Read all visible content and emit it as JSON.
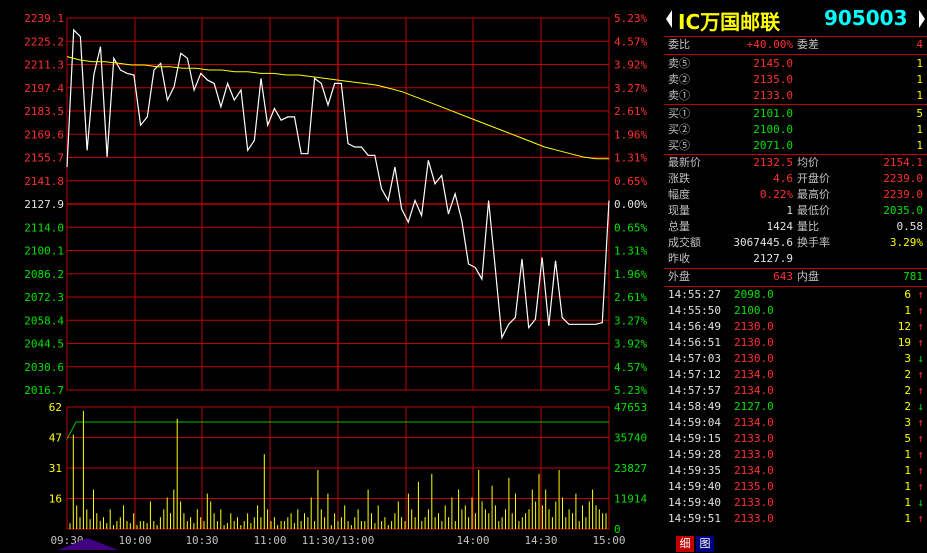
{
  "price_axis_left": [
    "2239.1",
    "2225.2",
    "2211.3",
    "2197.4",
    "2183.5",
    "2169.6",
    "2155.7",
    "2141.8",
    "2127.9",
    "2114.0",
    "2100.1",
    "2086.2",
    "2072.3",
    "2058.4",
    "2044.5",
    "2030.6",
    "2016.7"
  ],
  "price_axis_right": [
    "5.23%",
    "4.57%",
    "3.92%",
    "3.27%",
    "2.61%",
    "1.96%",
    "1.31%",
    "0.65%",
    "0.00%",
    "0.65%",
    "1.31%",
    "1.96%",
    "2.61%",
    "3.27%",
    "3.92%",
    "4.57%",
    "5.23%"
  ],
  "vol_axis_left": [
    "62",
    "47",
    "31",
    "16"
  ],
  "vol_axis_right": [
    "47653",
    "35740",
    "23827",
    "11914",
    "0"
  ],
  "time_labels": [
    "09:30",
    "10:00",
    "10:30",
    "11:00",
    "11:30/13:00",
    "14:00",
    "14:30",
    "15:00"
  ],
  "chart_data": {
    "type": "line",
    "series": [
      {
        "values": [
          2150,
          2232,
          2228,
          2160,
          2205,
          2222,
          2156,
          2215,
          2208,
          2206,
          2205,
          2175,
          2180,
          2208,
          2212,
          2190,
          2198,
          2218,
          2215,
          2196,
          2206,
          2202,
          2200,
          2186,
          2200,
          2190,
          2196,
          2160,
          2166,
          2203,
          2175,
          2185,
          2178,
          2180,
          2180,
          2158,
          2158,
          2203,
          2200,
          2187,
          2200,
          2200,
          2164,
          2162,
          2162,
          2157,
          2157,
          2137,
          2130,
          2150,
          2125,
          2117,
          2130,
          2121,
          2154,
          2140,
          2145,
          2122,
          2134,
          2118,
          2092,
          2090,
          2083,
          2130,
          2090,
          2048,
          2056,
          2060,
          2095,
          2054,
          2059,
          2096,
          2055,
          2094,
          2060,
          2056,
          2056,
          2056,
          2056,
          2056,
          2057,
          2130
        ]
      },
      {
        "values": [
          2216,
          2214,
          2213,
          2213,
          2212,
          2211,
          2211,
          2210,
          2210,
          2209,
          2209,
          2208,
          2208,
          2207,
          2207,
          2206,
          2206,
          2205,
          2205,
          2204,
          2203,
          2202,
          2201,
          2200,
          2199,
          2197,
          2195,
          2192,
          2189,
          2186,
          2183,
          2180,
          2177,
          2174,
          2171,
          2168,
          2165,
          2162,
          2160,
          2158,
          2156,
          2155,
          2155
        ]
      }
    ],
    "volume_values": [
      3,
      48,
      12,
      6,
      60,
      10,
      5,
      20,
      8,
      4,
      6,
      3,
      10,
      2,
      4,
      6,
      12,
      4,
      3,
      8,
      2,
      4,
      4,
      3,
      14,
      4,
      2,
      6,
      10,
      16,
      8,
      20,
      56,
      14,
      8,
      4,
      6,
      3,
      10,
      6,
      4,
      18,
      14,
      8,
      4,
      10,
      2,
      3,
      8,
      4,
      6,
      2,
      4,
      8,
      3,
      6,
      12,
      6,
      38,
      10,
      4,
      6,
      2,
      4,
      4,
      6,
      8,
      3,
      10,
      4,
      8,
      6,
      16,
      4,
      30,
      10,
      6,
      18,
      2,
      8,
      4,
      6,
      12,
      4,
      2,
      6,
      10,
      4,
      4,
      20,
      8,
      3,
      12,
      4,
      6,
      2,
      4,
      8,
      14,
      6,
      4,
      18,
      10,
      6,
      24,
      4,
      6,
      10,
      28,
      6,
      8,
      4,
      12,
      6,
      16,
      4,
      20,
      10,
      12,
      6,
      16,
      8,
      30,
      14,
      10,
      8,
      22,
      12,
      4,
      6,
      10,
      26,
      8,
      18,
      4,
      6,
      8,
      10,
      20,
      14,
      28,
      12,
      20,
      10,
      6,
      14,
      30,
      16,
      6,
      10,
      8,
      18,
      4,
      12,
      6,
      14,
      20,
      12,
      10,
      8,
      8
    ]
  },
  "panel": {
    "title_name": "IC万国邮联",
    "title_code": "905003",
    "weibi_label": "委比",
    "weibi_value": "+40.00%",
    "weicha_label": "委差",
    "weicha_value": "4",
    "asks": [
      {
        "label": "卖⑤",
        "price": "2145.0",
        "vol": "1"
      },
      {
        "label": "卖②",
        "price": "2135.0",
        "vol": "1"
      },
      {
        "label": "卖①",
        "price": "2133.0",
        "vol": "1"
      }
    ],
    "bids": [
      {
        "label": "买①",
        "price": "2101.0",
        "vol": "5"
      },
      {
        "label": "买②",
        "price": "2100.0",
        "vol": "1"
      },
      {
        "label": "买⑤",
        "price": "2071.0",
        "vol": "1"
      }
    ],
    "stats": [
      {
        "l1": "最新价",
        "v1": "2132.5",
        "c1": "red",
        "l2": "均价",
        "v2": "2154.1",
        "c2": "red"
      },
      {
        "l1": "涨跌",
        "v1": "4.6",
        "c1": "red",
        "l2": "开盘价",
        "v2": "2239.0",
        "c2": "red"
      },
      {
        "l1": "幅度",
        "v1": "0.22%",
        "c1": "red",
        "l2": "最高价",
        "v2": "2239.0",
        "c2": "red"
      },
      {
        "l1": "现量",
        "v1": "1",
        "c1": "wht",
        "l2": "最低价",
        "v2": "2035.0",
        "c2": "grn"
      },
      {
        "l1": "总量",
        "v1": "1424",
        "c1": "wht",
        "l2": "量比",
        "v2": "0.58",
        "c2": "wht"
      },
      {
        "l1": "成交额",
        "v1": "3067445.6",
        "c1": "wht",
        "l2": "换手率",
        "v2": "3.29%",
        "c2": "yel"
      },
      {
        "l1": "昨收",
        "v1": "2127.9",
        "c1": "wht",
        "l2": "",
        "v2": "",
        "c2": "wht"
      }
    ],
    "waipan_label": "外盘",
    "waipan_value": "643",
    "neipan_label": "内盘",
    "neipan_value": "781",
    "ticks": [
      {
        "time": "14:55:27",
        "price": "2098.0",
        "pc": "grn",
        "vol": "6",
        "dir": "↑",
        "dc": "red"
      },
      {
        "time": "14:55:50",
        "price": "2100.0",
        "pc": "grn",
        "vol": "1",
        "dir": "↑",
        "dc": "red"
      },
      {
        "time": "14:56:49",
        "price": "2130.0",
        "pc": "red",
        "vol": "12",
        "dir": "↑",
        "dc": "red"
      },
      {
        "time": "14:56:51",
        "price": "2130.0",
        "pc": "red",
        "vol": "19",
        "dir": "↑",
        "dc": "red"
      },
      {
        "time": "14:57:03",
        "price": "2130.0",
        "pc": "red",
        "vol": "3",
        "dir": "↓",
        "dc": "grn"
      },
      {
        "time": "14:57:12",
        "price": "2134.0",
        "pc": "red",
        "vol": "2",
        "dir": "↑",
        "dc": "red"
      },
      {
        "time": "14:57:57",
        "price": "2134.0",
        "pc": "red",
        "vol": "2",
        "dir": "↑",
        "dc": "red"
      },
      {
        "time": "14:58:49",
        "price": "2127.0",
        "pc": "grn",
        "vol": "2",
        "dir": "↓",
        "dc": "grn"
      },
      {
        "time": "14:59:04",
        "price": "2134.0",
        "pc": "red",
        "vol": "3",
        "dir": "↑",
        "dc": "red"
      },
      {
        "time": "14:59:15",
        "price": "2133.0",
        "pc": "red",
        "vol": "5",
        "dir": "↑",
        "dc": "red"
      },
      {
        "time": "14:59:28",
        "price": "2133.0",
        "pc": "red",
        "vol": "1",
        "dir": "↑",
        "dc": "red"
      },
      {
        "time": "14:59:35",
        "price": "2134.0",
        "pc": "red",
        "vol": "1",
        "dir": "↑",
        "dc": "red"
      },
      {
        "time": "14:59:40",
        "price": "2135.0",
        "pc": "red",
        "vol": "1",
        "dir": "↑",
        "dc": "red"
      },
      {
        "time": "14:59:40",
        "price": "2133.0",
        "pc": "red",
        "vol": "1",
        "dir": "↓",
        "dc": "grn"
      },
      {
        "time": "14:59:51",
        "price": "2133.0",
        "pc": "red",
        "vol": "1",
        "dir": "↑",
        "dc": "red"
      }
    ],
    "tab_detail": "细",
    "tab_chart": "图"
  }
}
